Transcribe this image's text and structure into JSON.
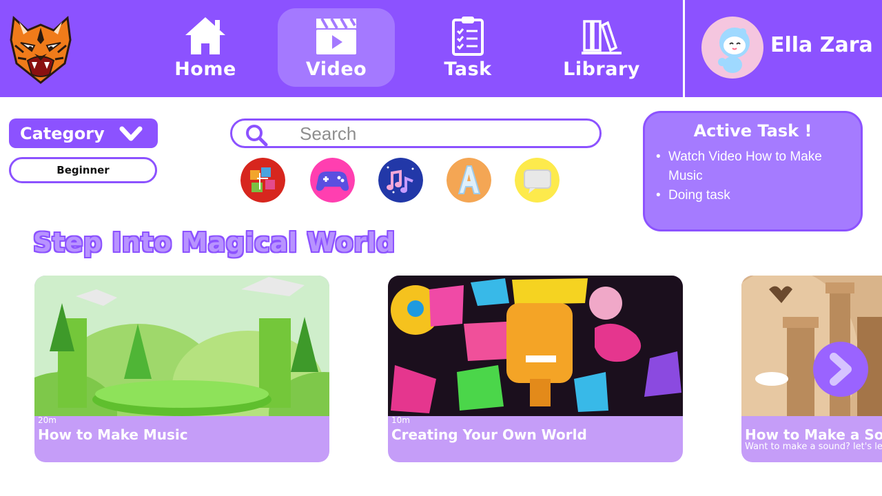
{
  "nav": {
    "items": [
      {
        "label": "Home",
        "icon": "home-icon"
      },
      {
        "label": "Video",
        "icon": "clapperboard-icon",
        "active": true
      },
      {
        "label": "Task",
        "icon": "clipboard-checklist-icon"
      },
      {
        "label": "Library",
        "icon": "books-icon"
      }
    ]
  },
  "user": {
    "name": "Ella Zara"
  },
  "filters": {
    "category_label": "Category",
    "level": "Beginner"
  },
  "search": {
    "placeholder": "Search"
  },
  "categories": [
    {
      "icon": "art-icon"
    },
    {
      "icon": "gamepad-icon"
    },
    {
      "icon": "music-icon"
    },
    {
      "icon": "letter-a-icon"
    },
    {
      "icon": "chat-bubble-icon"
    }
  ],
  "active_task": {
    "title": "Active Task !",
    "items": [
      "Watch Video How to Make Music",
      "Doing task"
    ]
  },
  "section": {
    "title": "Step Into Magical World"
  },
  "videos": [
    {
      "duration": "20m",
      "title": "How to Make Music",
      "description": ""
    },
    {
      "duration": "10m",
      "title": "Creating Your Own World",
      "description": ""
    },
    {
      "duration": "",
      "title": "How to Make a Sound",
      "description": "Want to make a sound? let's learn it"
    }
  ],
  "colors": {
    "primary": "#8c52ff",
    "primary_light": "#a57bff",
    "card_footer": "#c59df8",
    "white": "#ffffff"
  }
}
